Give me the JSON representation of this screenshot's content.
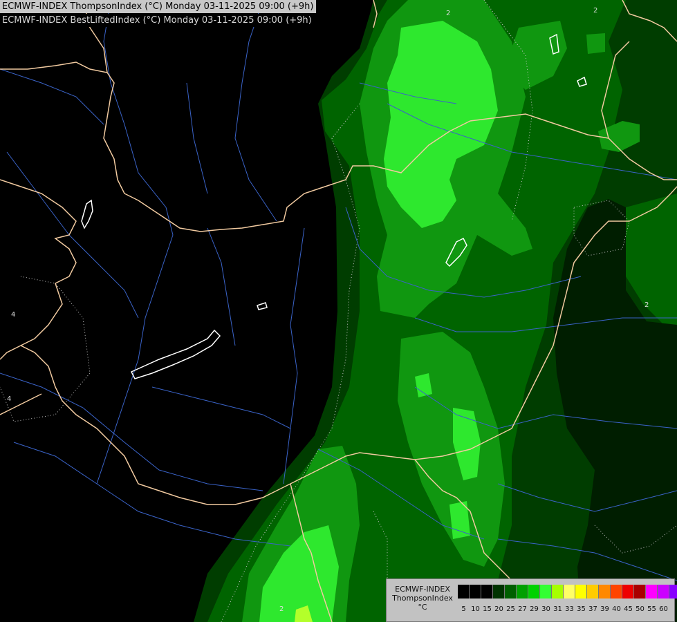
{
  "header": {
    "line1": "ECMWF-INDEX ThompsonIndex (°C) Monday 03-11-2025 09:00 (+9h)",
    "line2": "ECMWF-INDEX BestLiftedIndex (°C) Monday 03-11-2025 09:00 (+9h)"
  },
  "map": {
    "colors": {
      "background": "#000000",
      "level_20": "#003800",
      "level_25": "#005f00",
      "level_27": "#138c13",
      "level_29": "#1fce1f",
      "level_30": "#33ff33",
      "level_31": "#b4ff2a",
      "borders": "#f1caa0",
      "rivers": "#3a63c8",
      "lakes": "#ffffff",
      "contours": "#c8c8c8"
    },
    "contour_labels": [
      "2",
      "2",
      "4",
      "4",
      "2",
      "2"
    ]
  },
  "legend": {
    "title_line1": "ECMWF-INDEX",
    "title_line2": "ThompsonIndex",
    "title_line3": "°C",
    "ticks": [
      "5",
      "10",
      "15",
      "20",
      "25",
      "27",
      "29",
      "30",
      "31",
      "33",
      "35",
      "37",
      "39",
      "40",
      "45",
      "50",
      "55",
      "60"
    ],
    "colors": [
      "#000000",
      "#000000",
      "#000000",
      "#003300",
      "#005f00",
      "#00a000",
      "#00d200",
      "#33ff33",
      "#a6ff00",
      "#ffff66",
      "#ffff00",
      "#ffcc00",
      "#ff8800",
      "#ff4400",
      "#ee0000",
      "#aa0000",
      "#ff00ff",
      "#cc00ff",
      "#8800ff",
      "#4400ff",
      "#0000ff"
    ]
  }
}
